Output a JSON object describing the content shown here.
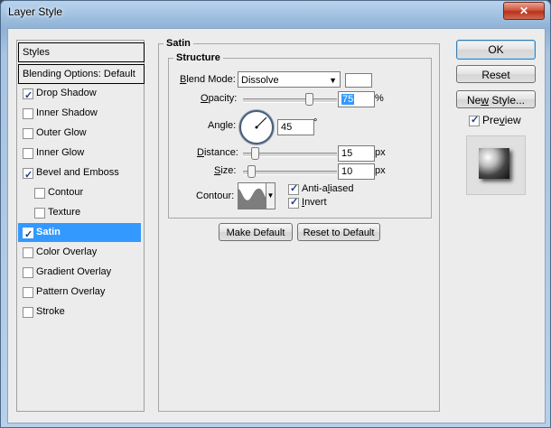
{
  "window": {
    "title": "Layer Style",
    "close_label": "✕"
  },
  "styles_list": {
    "header": "Styles",
    "blending": "Blending Options: Default",
    "items": [
      {
        "label": "Drop Shadow",
        "checked": true
      },
      {
        "label": "Inner Shadow",
        "checked": false
      },
      {
        "label": "Outer Glow",
        "checked": false
      },
      {
        "label": "Inner Glow",
        "checked": false
      },
      {
        "label": "Bevel and Emboss",
        "checked": true
      },
      {
        "label": "Contour",
        "checked": false
      },
      {
        "label": "Texture",
        "checked": false
      },
      {
        "label": "Satin",
        "checked": true
      },
      {
        "label": "Color Overlay",
        "checked": false
      },
      {
        "label": "Gradient Overlay",
        "checked": false
      },
      {
        "label": "Pattern Overlay",
        "checked": false
      },
      {
        "label": "Stroke",
        "checked": false
      }
    ]
  },
  "satin": {
    "group_title": "Satin",
    "structure_title": "Structure",
    "blend_mode": {
      "label_pre": "B",
      "label_rest": "lend Mode:",
      "value": "Dissolve",
      "color": "#ffffff"
    },
    "opacity": {
      "label_pre": "O",
      "label_rest": "pacity:",
      "value": "75",
      "unit": "%"
    },
    "angle": {
      "label": "Angle:",
      "value": "45",
      "unit": "°"
    },
    "distance": {
      "label_pre": "D",
      "label_rest": "istance:",
      "value": "15",
      "unit": "px"
    },
    "size": {
      "label_pre": "S",
      "label_rest": "ize:",
      "value": "10",
      "unit": "px"
    },
    "contour": {
      "label": "Contour:"
    },
    "anti_aliased": {
      "label_pre": "Anti-a",
      "label_u": "l",
      "label_post": "iased",
      "checked": true
    },
    "invert": {
      "label_u": "I",
      "label_rest": "nvert",
      "checked": true
    },
    "make_default": "Make Default",
    "reset_to_default": "Reset to Default"
  },
  "right_panel": {
    "ok": "OK",
    "reset": "Reset",
    "new_style_pre": "Ne",
    "new_style_u": "w",
    "new_style_post": " Style...",
    "preview_u": "v",
    "preview_pre": "Pre",
    "preview_post": "iew",
    "preview_checked": true
  }
}
